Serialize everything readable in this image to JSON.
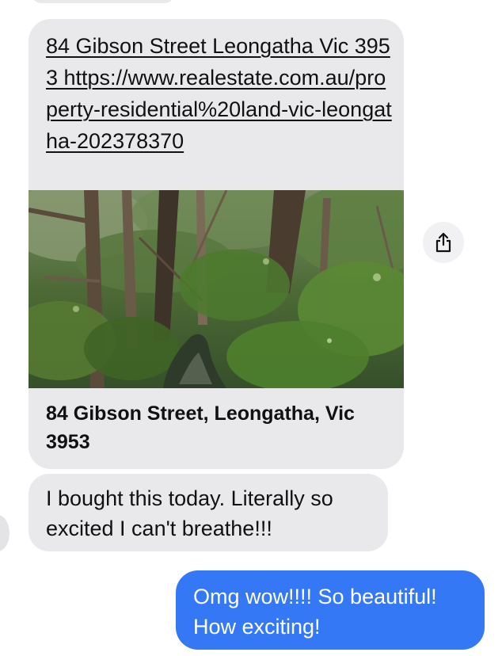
{
  "colors": {
    "incoming_bubble": "#e9e9eb",
    "outgoing_bubble": "#3478f6",
    "outgoing_text": "#ffffff",
    "incoming_text": "#111111"
  },
  "messages": [
    {
      "direction": "incoming",
      "type": "link-preview",
      "link_text": "84 Gibson Street Leongatha Vic 3953 https://www.realestate.com.au/property-residential%20land-vic-leongatha-202378370",
      "preview_title": "84 Gibson Street, Leongatha, Vic 3953",
      "preview_image_icon": "forest-creek-photo"
    },
    {
      "direction": "incoming",
      "type": "text",
      "text": "I bought this today. Literally so excited I can't breathe!!!"
    },
    {
      "direction": "outgoing",
      "type": "text",
      "text": "Omg wow!!!! So beautiful! How exciting!"
    }
  ],
  "share_button": {
    "icon": "share-icon"
  }
}
